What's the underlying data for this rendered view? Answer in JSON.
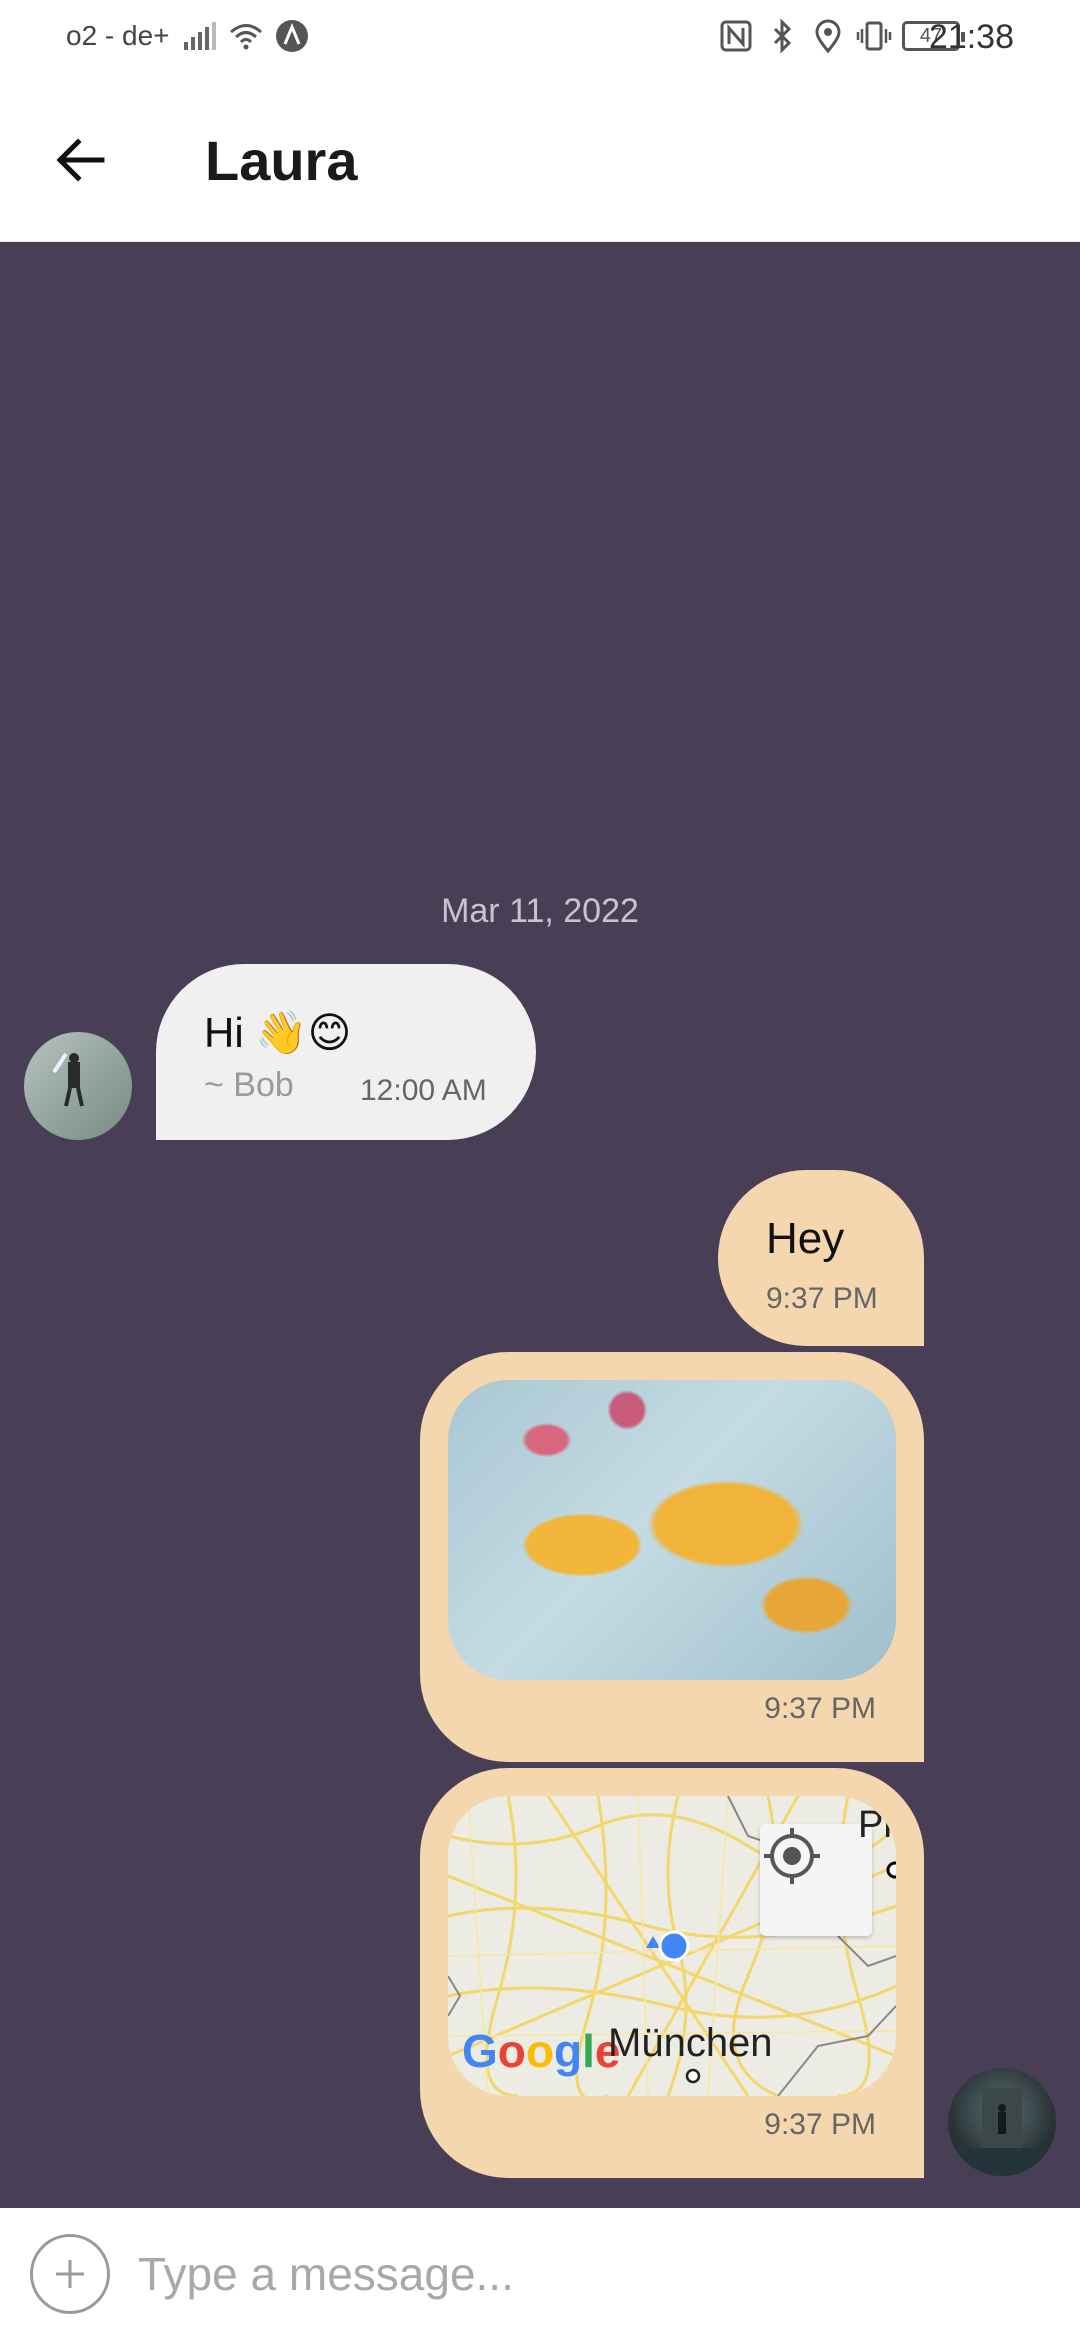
{
  "status_bar": {
    "carrier": "o2 - de+",
    "battery_level": "47",
    "time": "21:38",
    "icons": [
      "signal-icon",
      "wifi-icon",
      "app-notification-icon",
      "nfc-icon",
      "bluetooth-icon",
      "location-icon",
      "vibrate-icon",
      "battery-icon"
    ]
  },
  "app_bar": {
    "back_icon": "arrow-left-icon",
    "title": "Laura"
  },
  "chat": {
    "date_separator": "Mar 11, 2022",
    "messages": [
      {
        "direction": "incoming",
        "type": "text",
        "text": "Hi 👋😊",
        "sender": "~ Bob",
        "time": "12:00 AM"
      },
      {
        "direction": "outgoing",
        "type": "text",
        "text": "Hey",
        "time": "9:37 PM"
      },
      {
        "direction": "outgoing",
        "type": "image",
        "time": "9:37 PM"
      },
      {
        "direction": "outgoing",
        "type": "location",
        "map_label_city": "München",
        "map_label_partial": "Pr",
        "map_brand": "Google",
        "time": "9:37 PM"
      }
    ]
  },
  "input": {
    "attach_icon": "plus-circle-icon",
    "placeholder": "Type a message..."
  },
  "colors": {
    "chat_background": "#483f56",
    "incoming_bubble": "#f0f0f0",
    "outgoing_bubble": "#f4d7ae",
    "map_location_dot": "#4285f4"
  }
}
